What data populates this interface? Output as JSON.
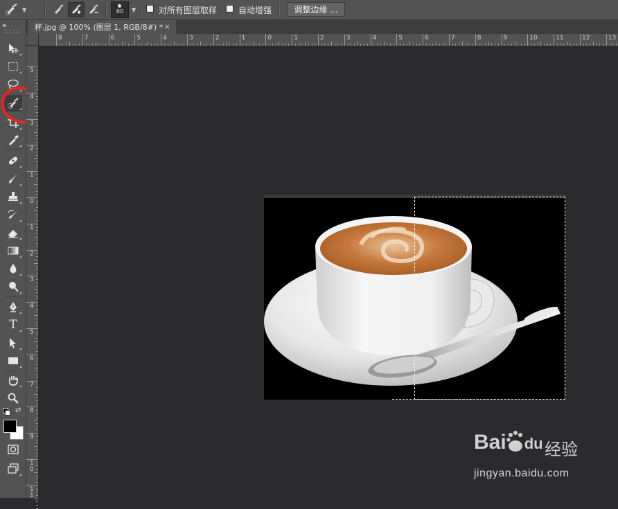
{
  "options_bar": {
    "brush_size": "60",
    "sample_all_layers_label": "对所有图层取样",
    "auto_enhance_label": "自动增强",
    "refine_edge_label": "调整边缘 ..."
  },
  "document_tab": {
    "title": "杯.jpg @ 100% (图层 1, RGB/8#) *",
    "close_glyph": "×"
  },
  "hruler_labels": [
    "8",
    "7",
    "6",
    "5",
    "4",
    "3",
    "2",
    "1",
    "0",
    "1",
    "2",
    "3",
    "4",
    "5",
    "6",
    "7",
    "8",
    "9",
    "10",
    "11",
    "12",
    "13"
  ],
  "vruler_labels": [
    "5",
    "4",
    "3",
    "2",
    "1",
    "0",
    "1",
    "2",
    "3",
    "4",
    "5",
    "6",
    "7",
    "8",
    "9",
    "1\n0",
    "1\n1"
  ],
  "tools": [
    "move-tool",
    "marquee-tool",
    "lasso-tool",
    "quick-selection-tool",
    "crop-tool",
    "eyedropper-tool",
    "healing-brush-tool",
    "brush-tool",
    "clone-stamp-tool",
    "history-brush-tool",
    "eraser-tool",
    "gradient-tool",
    "blur-tool",
    "dodge-tool",
    "pen-tool",
    "type-tool",
    "path-selection-tool",
    "rectangle-tool",
    "hand-tool",
    "zoom-tool"
  ],
  "type_tool_glyph": "T",
  "colors": {
    "foreground": "#000000",
    "background": "#ffffff",
    "annotation": "#e8241f"
  },
  "watermark": {
    "logo_text": "Bai",
    "logo_text_2": "du",
    "cn_text": "经验",
    "url": "jingyan.baidu.com"
  }
}
